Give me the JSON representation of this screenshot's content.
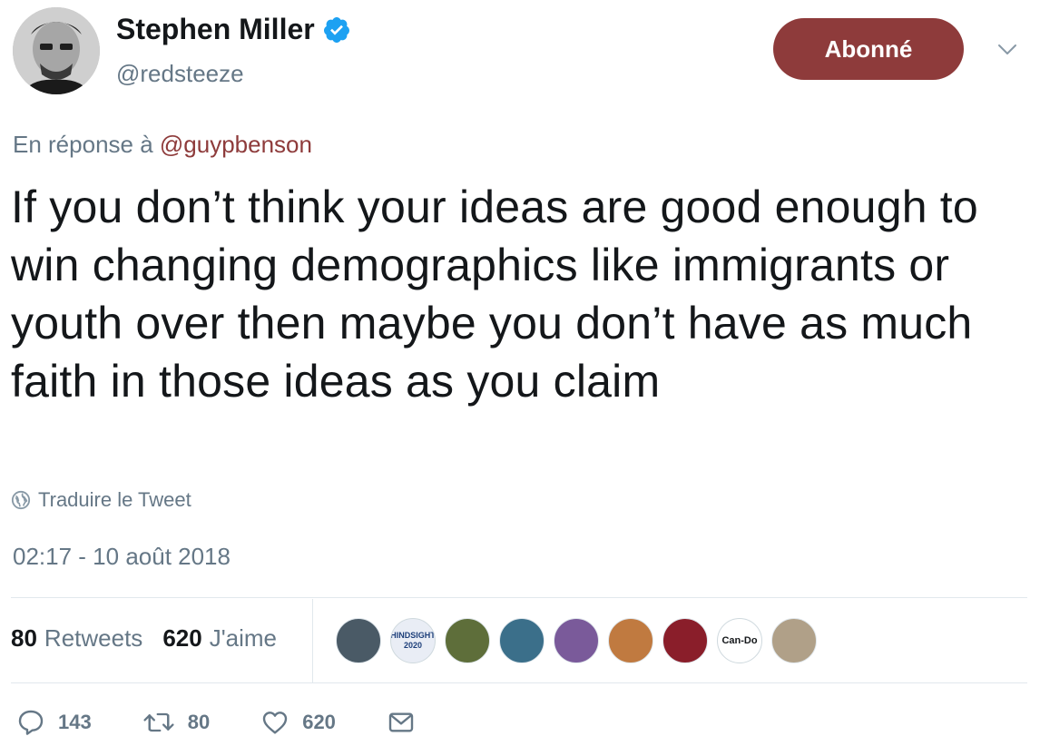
{
  "user": {
    "display_name": "Stephen Miller",
    "handle": "@redsteeze",
    "verified_icon": "verified-badge-icon"
  },
  "header": {
    "follow_label": "Abonné",
    "menu_icon": "chevron-down-icon"
  },
  "reply": {
    "prefix": "En réponse à",
    "mention": "@guypbenson"
  },
  "tweet": {
    "text": "If you don’t think your ideas are good enough to win changing demographics like immigrants or youth over then maybe you don’t have as much faith in those ideas as you claim",
    "translate_label": "Traduire le Tweet",
    "timestamp": "02:17 - 10 août 2018"
  },
  "stats": {
    "retweets_count": "80",
    "retweets_label": "Retweets",
    "likes_count": "620",
    "likes_label": "J'aime"
  },
  "likers": [
    {
      "name": "liker-avatar-1",
      "color": "#4a5a66"
    },
    {
      "name": "liker-avatar-2",
      "color": "#e9edf5",
      "text": "HINDSIGHT 2020"
    },
    {
      "name": "liker-avatar-3",
      "color": "#5e6e3a"
    },
    {
      "name": "liker-avatar-4",
      "color": "#3b6f8a"
    },
    {
      "name": "liker-avatar-5",
      "color": "#7a5a9a"
    },
    {
      "name": "liker-avatar-6",
      "color": "#c07a40"
    },
    {
      "name": "liker-avatar-7",
      "color": "#8a1e2a"
    },
    {
      "name": "liker-avatar-8",
      "color": "#ffffff",
      "text": "Can-Do"
    },
    {
      "name": "liker-avatar-9",
      "color": "#b0a088"
    }
  ],
  "actions": {
    "reply_count": "143",
    "retweet_count": "80",
    "like_count": "620"
  },
  "colors": {
    "accent": "#8e3b3b",
    "muted": "#657786",
    "text": "#14171a",
    "verified": "#1da1f2"
  }
}
